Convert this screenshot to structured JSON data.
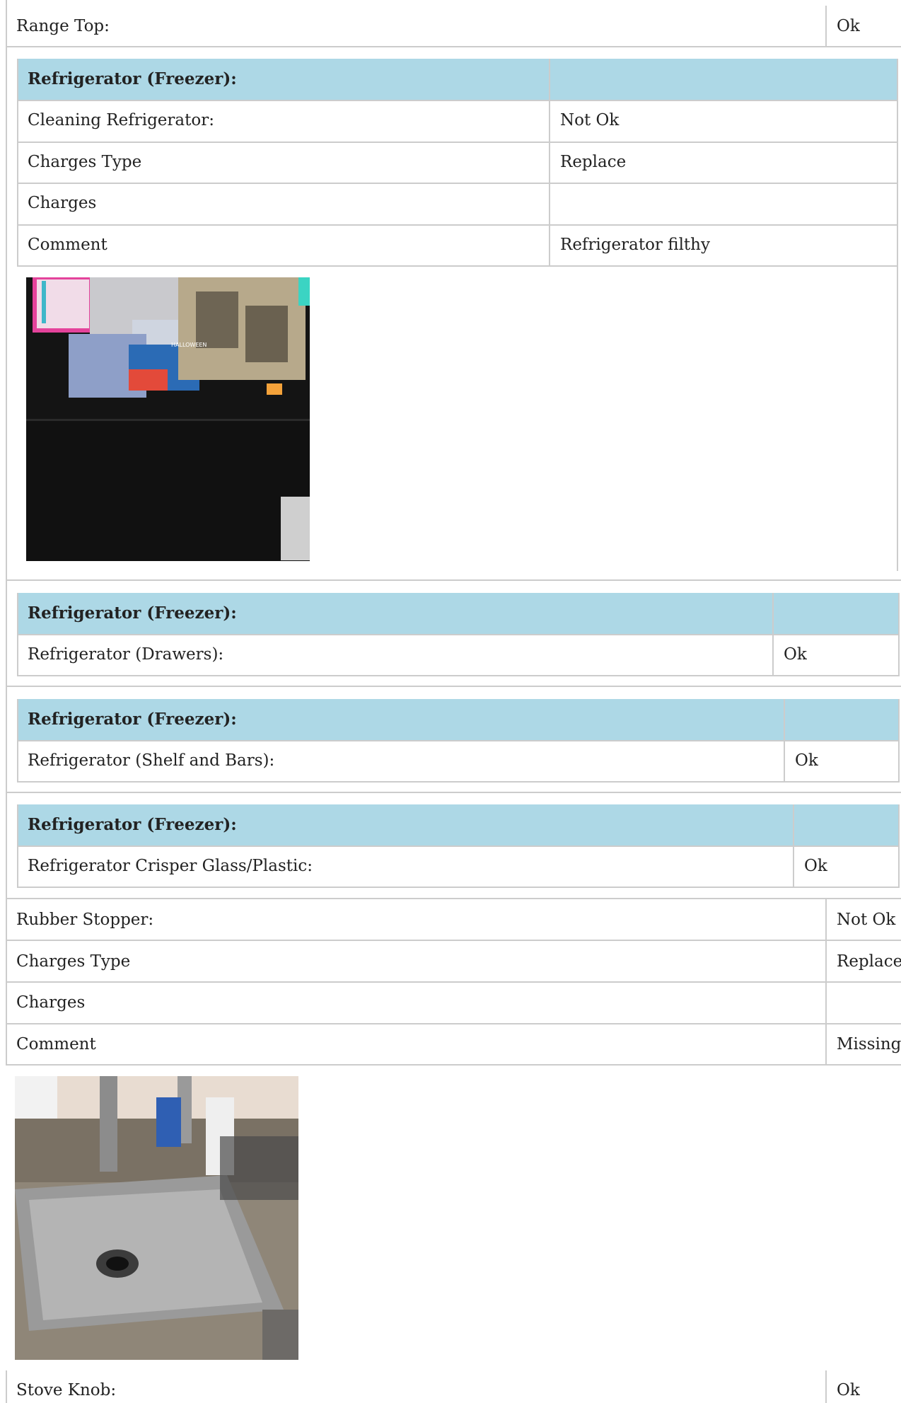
{
  "row_range_top": {
    "label": "Range Top:",
    "value": "Ok"
  },
  "section1": {
    "header": "Refrigerator (Freezer):",
    "rows": [
      {
        "label": "Cleaning Refrigerator:",
        "value": "Not Ok"
      },
      {
        "label": "Charges Type",
        "value": "Replace"
      },
      {
        "label": "Charges",
        "value": ""
      },
      {
        "label": "Comment",
        "value": "Refrigerator filthy"
      }
    ],
    "photo_text": "HALLOWEEN"
  },
  "section2": {
    "header": "Refrigerator (Freezer):",
    "label": "Refrigerator (Drawers):",
    "value": "Ok"
  },
  "section3": {
    "header": "Refrigerator (Freezer):",
    "label": "Refrigerator (Shelf and Bars):",
    "value": "Ok"
  },
  "section4": {
    "header": "Refrigerator (Freezer):",
    "label": "Refrigerator Crisper Glass/Plastic:",
    "value": "Ok"
  },
  "rubber": {
    "rows": [
      {
        "label": "Rubber Stopper:",
        "value": "Not Ok"
      },
      {
        "label": "Charges Type",
        "value": "Replace"
      },
      {
        "label": "Charges",
        "value": ""
      },
      {
        "label": "Comment",
        "value": "Missing"
      }
    ]
  },
  "row_stove_knob": {
    "label": "Stove Knob:",
    "value": "Ok"
  },
  "colors": {
    "header_bg": "#add8e6",
    "border": "#cccccc"
  }
}
